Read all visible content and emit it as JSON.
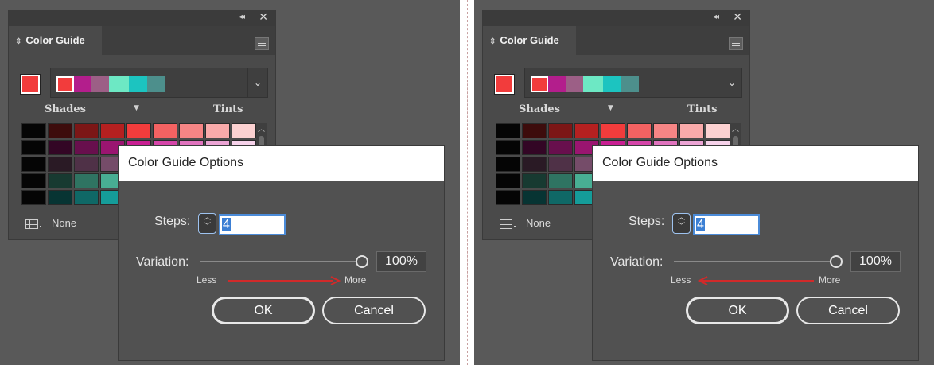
{
  "panels": [
    {
      "panel_title": "Color Guide",
      "shades_label": "Shades",
      "tints_label": "Tints",
      "swatch_library_label": "None",
      "dialog": {
        "title": "Color Guide Options",
        "steps_label": "Steps:",
        "steps_value": "4",
        "variation_label": "Variation:",
        "variation_value": "100%",
        "less_label": "Less",
        "more_label": "More",
        "ok_label": "OK",
        "cancel_label": "Cancel",
        "annotation_arrow_direction": "toward More"
      }
    },
    {
      "panel_title": "Color Guide",
      "shades_label": "Shades",
      "tints_label": "Tints",
      "swatch_library_label": "None",
      "dialog": {
        "title": "Color Guide Options",
        "steps_label": "Steps:",
        "steps_value": "4",
        "variation_label": "Variation:",
        "variation_value": "100%",
        "less_label": "Less",
        "more_label": "More",
        "ok_label": "OK",
        "cancel_label": "Cancel",
        "annotation_arrow_direction": "toward Less"
      }
    }
  ],
  "colors": {
    "base_color": "#f23c3c",
    "annotation_arrow": "#d12a2a",
    "harmony_swatches": [
      "#f23c3c",
      "#b31e8c",
      "#9c5f86",
      "#6de8c4",
      "#1cc4c0",
      "#4d8f8c"
    ],
    "shade_tint_grid": [
      [
        "#050505",
        "#3d0c0c",
        "#7c1616",
        "#b52020",
        "#f23c3c",
        "#f46262",
        "#f68585",
        "#f9aaaa",
        "#fcd1d1"
      ],
      [
        "#050505",
        "#330625",
        "#680f4d",
        "#9a1570",
        "#c81f92",
        "#d545a9",
        "#e073be",
        "#eba4d4",
        "#f6d2ea"
      ],
      [
        "#050505",
        "#2a1a25",
        "#4f3147",
        "#754c69",
        "#9c5f86"
      ],
      [
        "#050505",
        "#173a31",
        "#2f7462",
        "#48ae93",
        "#6de8c4"
      ],
      [
        "#050505",
        "#073433",
        "#0f6866",
        "#159c99",
        "#1cc4c0"
      ]
    ]
  },
  "icons": {
    "collapse": "double-chevron-left-icon",
    "close": "close-icon",
    "tab_arrows": "up-down-arrows-icon",
    "panel_menu": "hamburger-menu-icon",
    "harmony_dropdown": "chevron-down-icon",
    "shades_menu": "triangle-down-icon",
    "swatch_library": "grid-table-icon",
    "stepper": "up-down-stepper-icon"
  }
}
